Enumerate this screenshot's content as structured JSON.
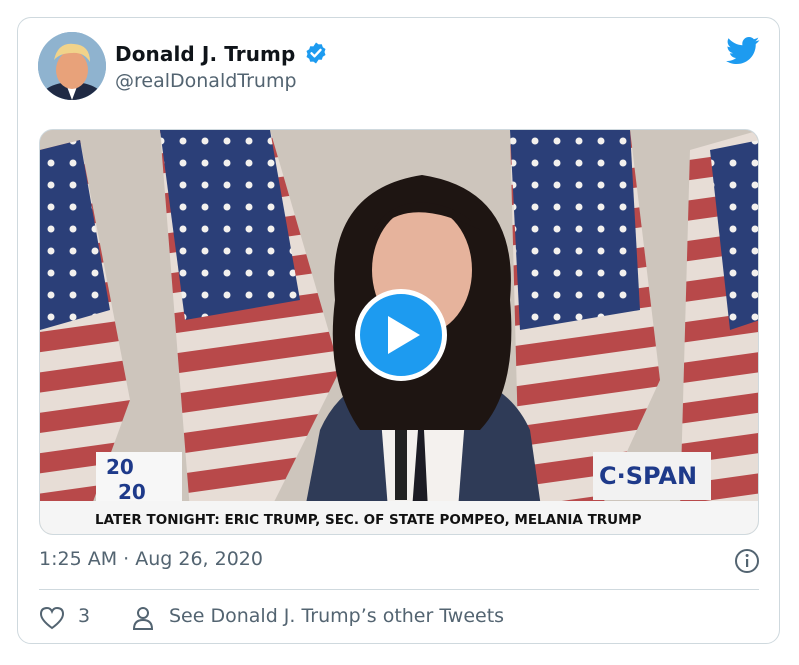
{
  "author": {
    "display_name": "Donald J. Trump",
    "handle": "@realDonaldTrump",
    "verified": true
  },
  "media": {
    "type": "video",
    "logo_left_line1": "20",
    "logo_left_line2": "20",
    "logo_right": "C·SPAN",
    "lower_third": "LATER TONIGHT: ERIC TRUMP, SEC. OF STATE POMPEO, MELANIA TRUMP"
  },
  "tweet": {
    "timestamp": "1:25 AM · Aug 26, 2020",
    "like_count": "3",
    "other_tweets_label": "See Donald J. Trump’s other Tweets"
  },
  "colors": {
    "accent": "#1d9bf0",
    "text_primary": "#0f1419",
    "text_secondary": "#536471",
    "border": "#cfd9de"
  },
  "icons": [
    "avatar",
    "verified-badge-icon",
    "twitter-bird-icon",
    "play-icon",
    "info-icon",
    "heart-icon",
    "person-icon"
  ]
}
